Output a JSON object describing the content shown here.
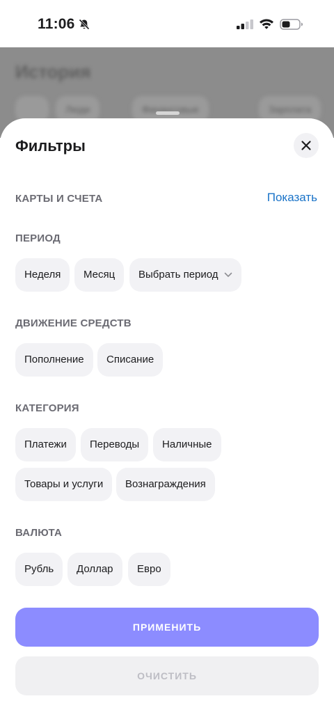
{
  "status_bar": {
    "time": "11:06"
  },
  "background": {
    "title": "История",
    "chips": [
      "Люди",
      "Финансовые",
      "Зарплата"
    ]
  },
  "sheet": {
    "title": "Фильтры",
    "cards": {
      "label": "КАРТЫ И СЧЕТА",
      "action": "Показать"
    },
    "period": {
      "label": "ПЕРИОД",
      "options": [
        "Неделя",
        "Месяц",
        "Выбрать период"
      ]
    },
    "movement": {
      "label": "ДВИЖЕНИЕ СРЕДСТВ",
      "options": [
        "Пополнение",
        "Списание"
      ]
    },
    "category": {
      "label": "КАТЕГОРИЯ",
      "options": [
        "Платежи",
        "Переводы",
        "Наличные",
        "Товары и услуги",
        "Вознаграждения"
      ]
    },
    "currency": {
      "label": "ВАЛЮТА",
      "options": [
        "Рубль",
        "Доллар",
        "Евро"
      ]
    },
    "apply_label": "ПРИМЕНИТЬ",
    "clear_label": "ОЧИСТИТЬ"
  },
  "colors": {
    "accent": "#8c8cff",
    "link": "#1a73c8",
    "chip_bg": "#f2f2f5"
  }
}
